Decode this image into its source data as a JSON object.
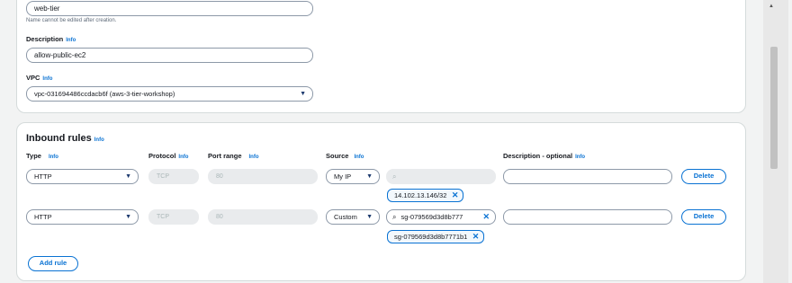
{
  "general": {
    "name_value": "web-tier",
    "name_hint": "Name cannot be edited after creation.",
    "description_label": "Description",
    "description_info": "Info",
    "description_value": "allow-public-ec2",
    "vpc_label": "VPC",
    "vpc_info": "Info",
    "vpc_value": "vpc-031694486ccdacb6f (aws-3-tier-workshop)"
  },
  "inbound": {
    "title": "Inbound rules",
    "title_info": "Info",
    "headers": {
      "type": "Type",
      "type_info": "Info",
      "protocol": "Protocol",
      "protocol_info": "Info",
      "port_range": "Port range",
      "port_info": "Info",
      "source": "Source",
      "source_info": "Info",
      "description": "Description - optional",
      "description_info": "Info"
    },
    "rules": [
      {
        "type": "HTTP",
        "protocol": "TCP",
        "port": "80",
        "source_type": "My IP",
        "search_value": "",
        "token": "14.102.13.146/32",
        "description": "",
        "delete_label": "Delete"
      },
      {
        "type": "HTTP",
        "protocol": "TCP",
        "port": "80",
        "source_type": "Custom",
        "search_value": "sg-079569d3d8b777",
        "token": "sg-079569d3d8b7771b1",
        "description": "",
        "delete_label": "Delete"
      }
    ],
    "add_rule_label": "Add rule"
  },
  "icons": {
    "caret": "▼",
    "search": "⌕",
    "dismiss": "✕",
    "scroll_up": "▲"
  },
  "colors": {
    "accent": "#0972d3",
    "border": "#8d99a8",
    "disabled_bg": "#e9ebed"
  }
}
